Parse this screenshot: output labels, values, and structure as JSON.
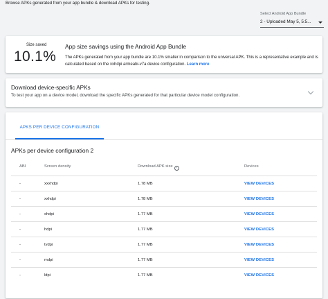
{
  "intro_text": "Browse APKs generated from your app bundle & download APKs for testing.",
  "app_bundle_select": {
    "label": "Select Android App Bundle",
    "value": "2 - Uploaded May 5, 5:5..."
  },
  "savings_card": {
    "size_saved_label": "Size saved",
    "size_saved_value": "10.1%",
    "title": "App size savings using the Android App Bundle",
    "description": "The APKs generated from your app bundle are 10.1% smaller in comparison to the universal APK. This is a representative example and is calculated based on the xxhdpi armeabi-v7a device configuration.",
    "learn_more": "Learn more"
  },
  "download_card": {
    "title": "Download device-specific APKs",
    "description": "To test your app on a device model, download the specific APKs generated for that particular device model configuration."
  },
  "tab": {
    "label": "APKS PER DEVICE CONFIGURATION"
  },
  "section_title": "APKs per device configuration 2",
  "table": {
    "headers": {
      "abi": "ABI",
      "density": "Screen density",
      "size": "Download APK size",
      "devices": "Devices"
    },
    "rows": [
      {
        "abi": "-",
        "density": "xxxhdpi",
        "size": "1.78 MB",
        "action": "VIEW DEVICES"
      },
      {
        "abi": "-",
        "density": "xxhdpi",
        "size": "1.78 MB",
        "action": "VIEW DEVICES"
      },
      {
        "abi": "-",
        "density": "xhdpi",
        "size": "1.77 MB",
        "action": "VIEW DEVICES"
      },
      {
        "abi": "-",
        "density": "hdpi",
        "size": "1.77 MB",
        "action": "VIEW DEVICES"
      },
      {
        "abi": "-",
        "density": "tvdpi",
        "size": "1.77 MB",
        "action": "VIEW DEVICES"
      },
      {
        "abi": "-",
        "density": "mdpi",
        "size": "1.77 MB",
        "action": "VIEW DEVICES"
      },
      {
        "abi": "-",
        "density": "ldpi",
        "size": "1.77 MB",
        "action": "VIEW DEVICES"
      }
    ]
  },
  "colors": {
    "accent": "#1a73e8",
    "background": "#f1f3f4",
    "card": "#ffffff"
  },
  "icons": {
    "select": "caret-down-icon",
    "help": "help-circle-icon",
    "expand": "chevron-down-icon"
  }
}
